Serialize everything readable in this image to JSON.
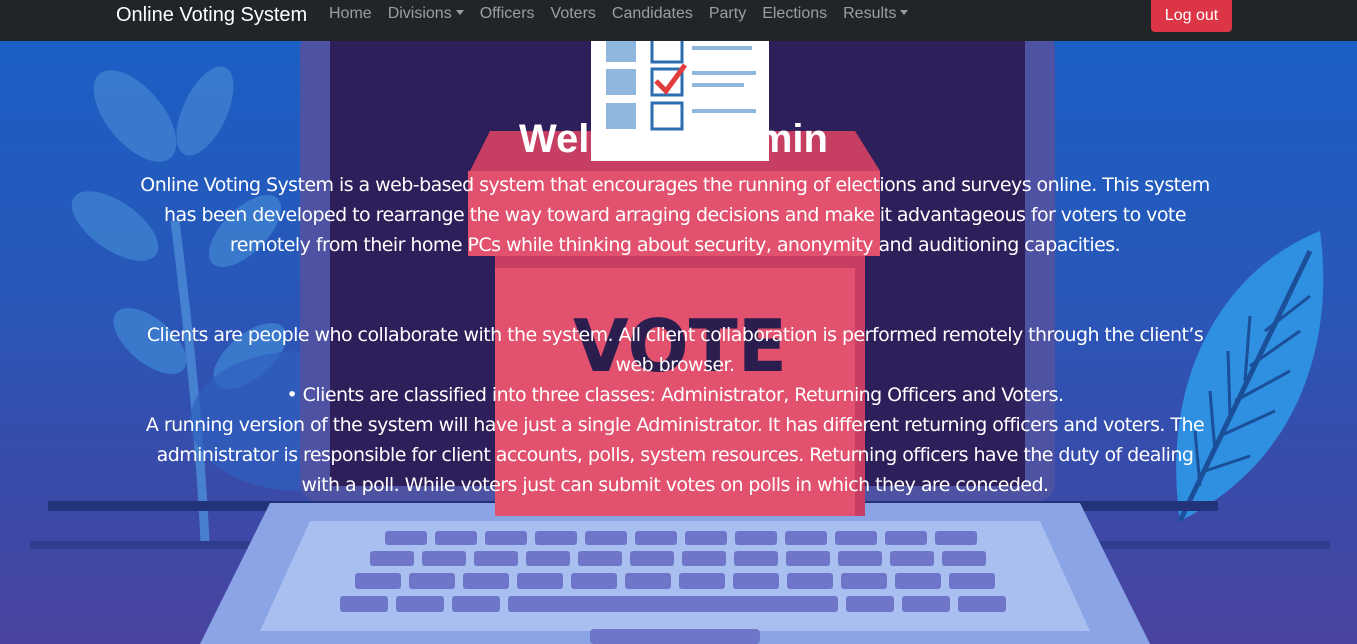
{
  "navbar": {
    "brand": "Online Voting System",
    "items": [
      {
        "label": "Home",
        "dropdown": false
      },
      {
        "label": "Divisions",
        "dropdown": true
      },
      {
        "label": "Officers",
        "dropdown": false
      },
      {
        "label": "Voters",
        "dropdown": false
      },
      {
        "label": "Candidates",
        "dropdown": false
      },
      {
        "label": "Party",
        "dropdown": false
      },
      {
        "label": "Elections",
        "dropdown": false
      },
      {
        "label": "Results",
        "dropdown": true
      }
    ],
    "logout_label": "Log out"
  },
  "hero": {
    "illustration_text": "VOTE",
    "title": "Welcome Admin",
    "intro": "Online Voting System is a web-based system that encourages the running of elections and surveys online. This system has been developed to rearrange the way toward arraging decisions and make it advantageous for voters to vote remotely from their home PCs while thinking about security, anonymity and auditioning capacities.",
    "clients_lines": [
      "Clients are people who collaborate with the system. All client collaboration is performed remotely through the client’s web browser.",
      "• Clients are classified into three classes: Administrator, Returning Officers and Voters.",
      "A running version of the system will have just a single Administrator. It has different returning officers and voters. The administrator is responsible for client accounts, polls, system resources. Returning officers have the duty of dealing with a poll. While voters just can submit votes on polls in which they are conceded."
    ]
  },
  "colors": {
    "navbar_bg": "#212529",
    "logout_bg": "#dc3545",
    "ballot_box": "#e2516e",
    "background": "#1e66c4"
  }
}
